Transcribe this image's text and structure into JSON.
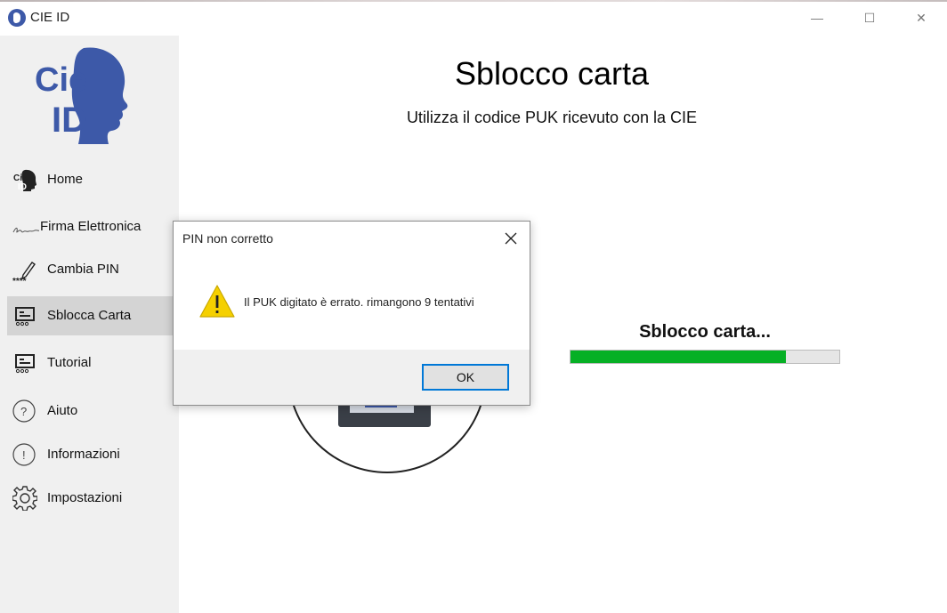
{
  "window": {
    "title": "CIE ID",
    "controls": {
      "minimize": "—",
      "maximize": "☐",
      "close": "✕"
    }
  },
  "sidebar": {
    "logo_text": [
      "Cie",
      "ID"
    ],
    "items": [
      {
        "label": "Home",
        "icon": "cie-id-icon"
      },
      {
        "label": "Firma Elettronica",
        "icon": "signature-icon"
      },
      {
        "label": "Cambia PIN",
        "icon": "pencil-pin-icon"
      },
      {
        "label": "Sblocca Carta",
        "icon": "card-reader-icon",
        "active": true
      },
      {
        "label": "Tutorial",
        "icon": "card-reader-icon"
      },
      {
        "label": "Aiuto",
        "icon": "question-icon"
      },
      {
        "label": "Informazioni",
        "icon": "info-exclamation-icon"
      },
      {
        "label": "Impostazioni",
        "icon": "gear-icon"
      }
    ]
  },
  "main": {
    "title": "Sblocco carta",
    "subtitle": "Utilizza il codice PUK ricevuto con la CIE",
    "progress": {
      "label": "Sblocco carta...",
      "value": 0.8,
      "color": "#06b025"
    }
  },
  "dialog": {
    "title": "PIN non corretto",
    "message": "Il PUK digitato è errato. rimangono 9 tentativi",
    "icon": "warning-icon",
    "ok_label": "OK"
  },
  "colors": {
    "brand_blue": "#3d59a8",
    "focus_blue": "#0078d7",
    "warning_yellow": "#f5d000"
  }
}
